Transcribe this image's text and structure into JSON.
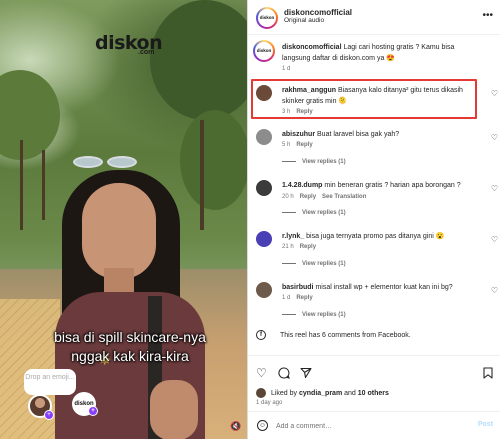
{
  "video": {
    "logo_text": "diskon",
    "logo_sub": ".com",
    "caption_line1": "bisa di spill skincare-nya",
    "caption_line2": "nggak kak kira-kira",
    "drop_prompt": "Drop an emoji...",
    "right_avatar_text": "diskon",
    "badge_symbol": "+"
  },
  "header": {
    "username": "diskoncomofficial",
    "audio": "Original audio",
    "avatar_text": "diskon",
    "more_icon": "more-icon"
  },
  "caption": {
    "username": "diskoncomofficial",
    "text": "Lagi cari hosting gratis ? Kamu bisa langsung daftar di diskon.com ya 😍",
    "time": "1 d"
  },
  "comments": [
    {
      "username": "rakhma_anggun",
      "text": "Biasanya kalo ditanya² gitu terus dikasih skinker gratis min 🫠",
      "time": "3 h",
      "reply": "Reply",
      "avatar_color": "#6b4a3a",
      "highlighted": true
    },
    {
      "username": "abiszuhur",
      "text": "Buat laravel bisa gak yah?",
      "time": "5 h",
      "reply": "Reply",
      "view_replies": "View replies (1)",
      "avatar_color": "#8c8c8c"
    },
    {
      "username": "1.4.28.dump",
      "text": "min beneran gratis ? harian apa borongan ?",
      "time": "20 h",
      "reply": "Reply",
      "translation": "See Translation",
      "view_replies": "View replies (1)",
      "avatar_color": "#3b3b3b"
    },
    {
      "username": "r.lynk_",
      "text": "bisa juga ternyata promo pas ditanya gini 😮",
      "time": "21 h",
      "reply": "Reply",
      "view_replies": "View replies (1)",
      "avatar_color": "#4a3fb5"
    },
    {
      "username": "basirbudi",
      "text": "misal install wp + elementor kuat kan ini bg?",
      "time": "1 d",
      "reply": "Reply",
      "view_replies": "View replies (1)",
      "avatar_color": "#6d5a4a"
    }
  ],
  "hidden_note": "This reel has 6 comments from Facebook.",
  "likes": {
    "prefix": "Liked by",
    "user": "cyndia_pram",
    "and": "and",
    "others": "10 others",
    "date": "1 day ago"
  },
  "add_comment": {
    "placeholder": "Add a comment…",
    "post_label": "Post"
  },
  "icons": [
    "heart-icon",
    "comment-icon",
    "share-icon",
    "bookmark-icon",
    "emoji-icon",
    "facebook-icon",
    "more-icon",
    "mute-icon"
  ],
  "colors": {
    "highlight_border": "#e53935",
    "post_button": "#b2dffc",
    "badge": "#8a3ffc"
  }
}
